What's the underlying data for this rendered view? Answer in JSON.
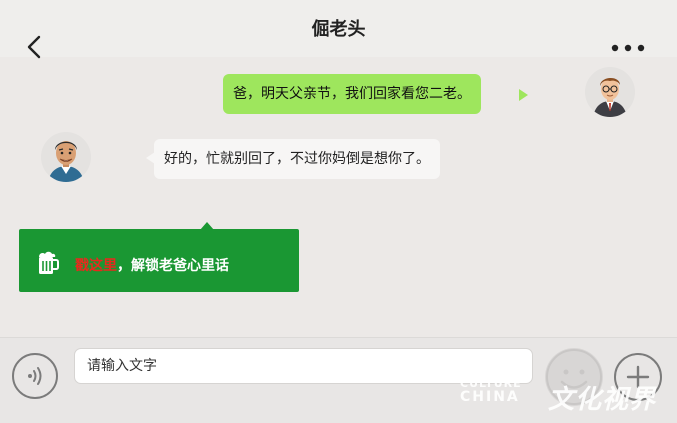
{
  "header": {
    "title": "倔老头",
    "back_icon": "chevron-left-icon",
    "more_icon": "more-horizontal-icon"
  },
  "messages": [
    {
      "direction": "outgoing",
      "text": "爸，明天父亲节，我们回家看您二老。"
    },
    {
      "direction": "incoming",
      "text": "好的，忙就别回了，不过你妈倒是想你了。"
    }
  ],
  "promo": {
    "icon": "beer-mug-icon",
    "highlight": "戳这里",
    "rest": "，解锁老爸心里话",
    "colors": {
      "background": "#1a9733",
      "highlight": "#e8291d"
    }
  },
  "input_bar": {
    "voice_icon": "voice-icon",
    "placeholder": "请输入文字",
    "emoji_icon": "emoji-icon",
    "plus_icon": "plus-icon"
  },
  "watermark": {
    "latin_1": "CULTURE",
    "latin_2": "CHINA",
    "cjk": "文化视界"
  },
  "colors": {
    "outgoing_bubble": "#9ee65d",
    "incoming_bubble": "#f7f6f5",
    "chat_background": "#ece9e7"
  }
}
